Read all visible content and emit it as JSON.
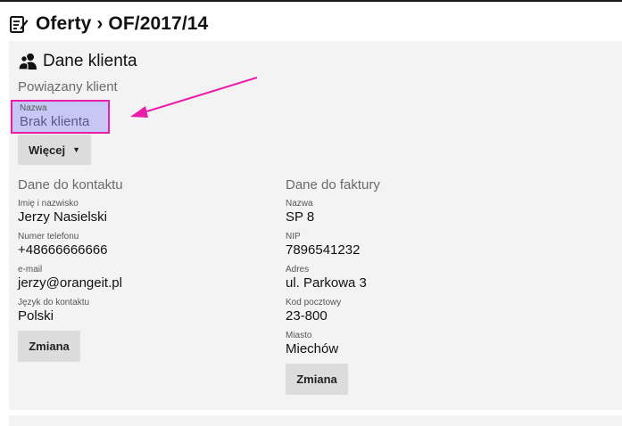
{
  "header": {
    "title": "Oferty › OF/2017/14",
    "icon": "edit-document-icon"
  },
  "client_section": {
    "title": "Dane klienta",
    "icon": "users-icon",
    "related_client_label": "Powiązany klient",
    "name_label": "Nazwa",
    "name_value": "Brak klienta",
    "more_button": "Więcej",
    "highlight_color": "#e91ea8",
    "highlight_fill": "#c7c7f5"
  },
  "contact": {
    "title": "Dane do kontaktu",
    "fields": [
      {
        "label": "Imię i nazwisko",
        "value": "Jerzy Nasielski"
      },
      {
        "label": "Numer telefonu",
        "value": "+48666666666"
      },
      {
        "label": "e-mail",
        "value": "jerzy@orangeit.pl"
      },
      {
        "label": "Język do kontaktu",
        "value": "Polski"
      }
    ],
    "change_button": "Zmiana"
  },
  "invoice": {
    "title": "Dane do faktury",
    "fields": [
      {
        "label": "Nazwa",
        "value": "SP 8"
      },
      {
        "label": "NIP",
        "value": "7896541232"
      },
      {
        "label": "Adres",
        "value": "ul. Parkowa 3"
      },
      {
        "label": "Kod pocztowy",
        "value": "23-800"
      },
      {
        "label": "Miasto",
        "value": "Miechów"
      }
    ],
    "change_button": "Zmiana"
  },
  "annotation": {
    "arrow_color": "#e91ea8"
  }
}
